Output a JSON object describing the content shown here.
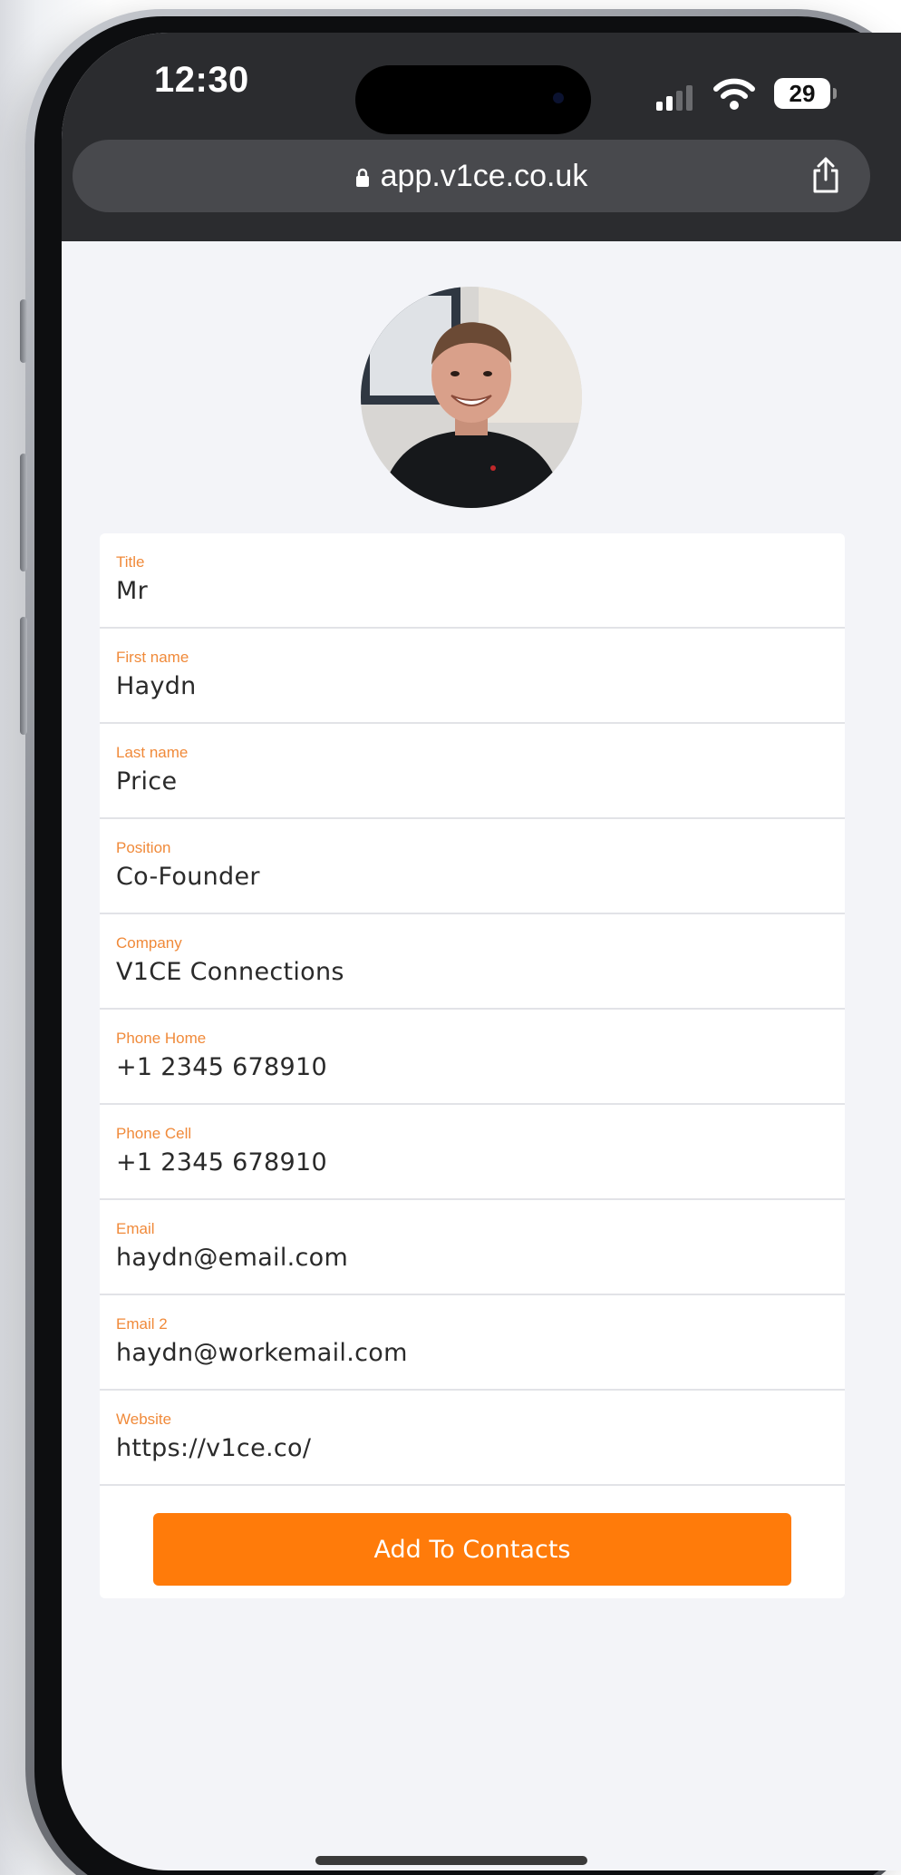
{
  "status_bar": {
    "time": "12:30",
    "battery": "29",
    "icons": [
      "signal-icon",
      "wifi-icon",
      "battery-icon"
    ]
  },
  "browser": {
    "url": "app.v1ce.co.uk",
    "icons": [
      "lock-icon",
      "share-icon"
    ]
  },
  "profile": {
    "avatar": "profile-photo"
  },
  "fields": [
    {
      "label": "Title",
      "value": "Mr"
    },
    {
      "label": "First name",
      "value": "Haydn"
    },
    {
      "label": "Last name",
      "value": "Price"
    },
    {
      "label": "Position",
      "value": "Co-Founder"
    },
    {
      "label": "Company",
      "value": "V1CE Connections"
    },
    {
      "label": "Phone Home",
      "value": "+1 2345 678910"
    },
    {
      "label": "Phone Cell",
      "value": "+1 2345 678910"
    },
    {
      "label": "Email",
      "value": "haydn@email.com"
    },
    {
      "label": "Email 2",
      "value": "haydn@workemail.com"
    },
    {
      "label": "Website",
      "value": "https://v1ce.co/"
    }
  ],
  "actions": {
    "add_to_contacts": "Add To Contacts"
  },
  "colors": {
    "accent": "#ff7b0a",
    "label": "#f08a3a",
    "background": "#f3f4f8",
    "topbar": "#2b2c2f"
  }
}
